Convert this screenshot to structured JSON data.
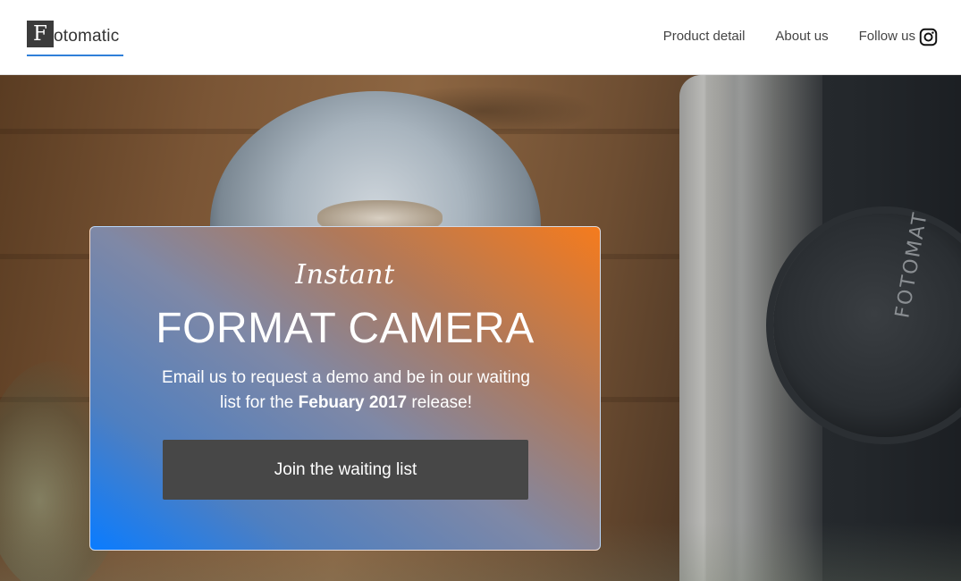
{
  "header": {
    "logo_letter": "F",
    "logo_text": "otomatic",
    "nav": {
      "product_detail": "Product detail",
      "about_us": "About us",
      "follow_us": "Follow us"
    },
    "follow_icon": "instagram-icon"
  },
  "hero": {
    "lens_brand": "FOTOMAT",
    "card": {
      "tagline": "Instant",
      "title": "FORMAT CAMERA",
      "desc_before": "Email us to request a demo and be in our waiting list for the ",
      "desc_bold": "Febuary 2017",
      "desc_after": " release!",
      "cta_label": "Join the waiting list"
    }
  },
  "colors": {
    "card_gradient_start": "#0a7cff",
    "card_gradient_end": "#f57b1d",
    "cta_background": "#474747",
    "logo_underline": "#2f7fd9"
  }
}
